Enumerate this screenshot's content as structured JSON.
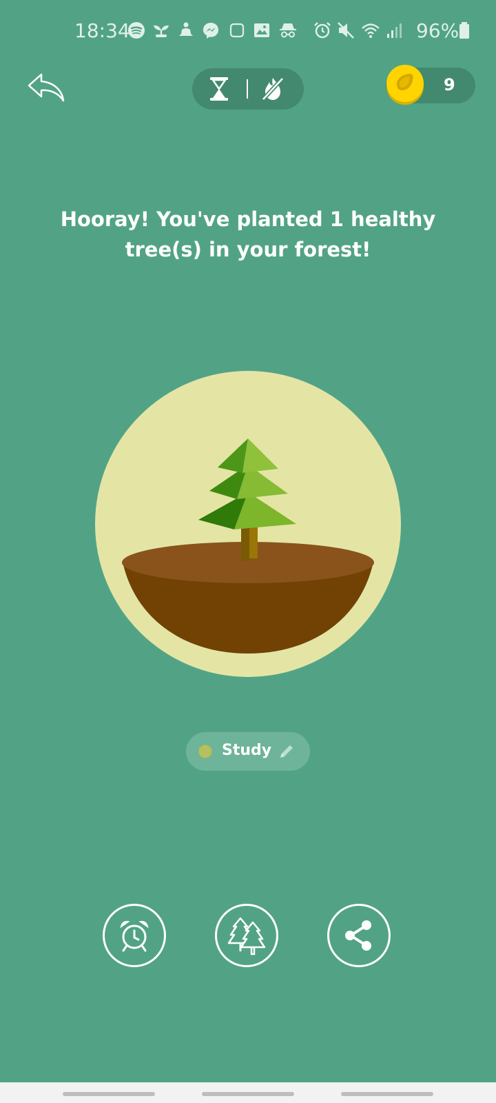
{
  "status_bar": {
    "time": "18:34",
    "battery_percent": "96%",
    "icons": [
      "spotify-icon",
      "sprout-icon",
      "meditation-icon",
      "messenger-icon",
      "square-icon",
      "image-icon",
      "incognito-icon",
      "alarm-icon",
      "mute-icon",
      "wifi-icon",
      "signal-icon",
      "battery-icon"
    ]
  },
  "header": {
    "back_icon": "back-arrow-icon",
    "mode_icons": [
      "hourglass-icon",
      "no-fire-icon"
    ],
    "coins": "9"
  },
  "message": "Hooray! You've planted 1 healthy tree(s) in your forest!",
  "tag": {
    "label": "Study",
    "color": "#b4c061"
  },
  "actions": [
    {
      "name": "alarm-clock-icon"
    },
    {
      "name": "forest-icon"
    },
    {
      "name": "share-icon"
    }
  ],
  "colors": {
    "background": "#52a386",
    "pill": "#43896f",
    "planet": "#e4e5a5",
    "soil": "#8a531b"
  }
}
